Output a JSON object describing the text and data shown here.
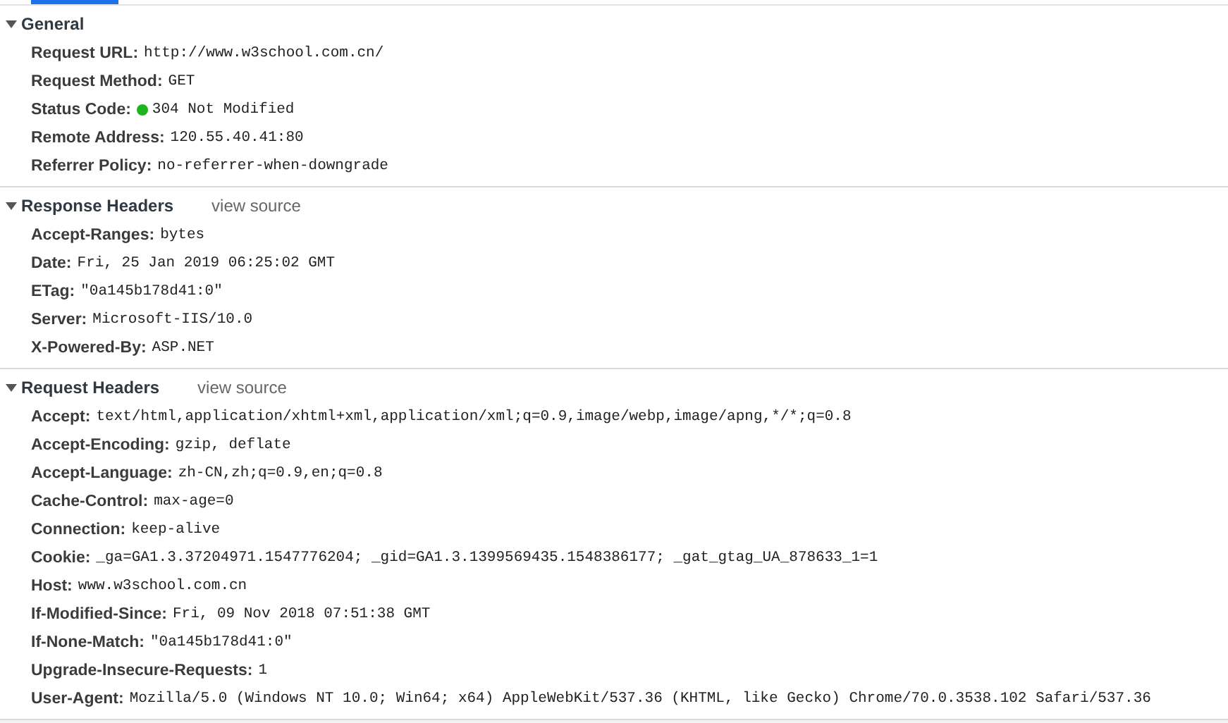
{
  "sections": [
    {
      "title": "General",
      "expanded": true,
      "rows": [
        {
          "kind": "plain",
          "name": "Request URL:",
          "value": "http://www.w3school.com.cn/"
        },
        {
          "kind": "plain",
          "name": "Request Method:",
          "value": "GET"
        },
        {
          "kind": "status",
          "name": "Status Code:",
          "value": "304 Not Modified",
          "color": "#1db51d"
        },
        {
          "kind": "plain",
          "name": "Remote Address:",
          "value": "120.55.40.41:80"
        },
        {
          "kind": "plain",
          "name": "Referrer Policy:",
          "value": "no-referrer-when-downgrade"
        }
      ]
    },
    {
      "title": "Response Headers",
      "link": "view source",
      "expanded": true,
      "rows": [
        {
          "kind": "plain",
          "name": "Accept-Ranges:",
          "value": "bytes"
        },
        {
          "kind": "plain",
          "name": "Date:",
          "value": "Fri, 25 Jan 2019 06:25:02 GMT"
        },
        {
          "kind": "plain",
          "name": "ETag:",
          "value": "\"0a145b178d41:0\""
        },
        {
          "kind": "plain",
          "name": "Server:",
          "value": "Microsoft-IIS/10.0"
        },
        {
          "kind": "plain",
          "name": "X-Powered-By:",
          "value": "ASP.NET"
        }
      ]
    },
    {
      "title": "Request Headers",
      "link": "view source",
      "expanded": true,
      "rows": [
        {
          "kind": "plain",
          "name": "Accept:",
          "value": "text/html,application/xhtml+xml,application/xml;q=0.9,image/webp,image/apng,*/*;q=0.8"
        },
        {
          "kind": "plain",
          "name": "Accept-Encoding:",
          "value": "gzip, deflate"
        },
        {
          "kind": "plain",
          "name": "Accept-Language:",
          "value": "zh-CN,zh;q=0.9,en;q=0.8"
        },
        {
          "kind": "plain",
          "name": "Cache-Control:",
          "value": "max-age=0"
        },
        {
          "kind": "plain",
          "name": "Connection:",
          "value": "keep-alive"
        },
        {
          "kind": "plain",
          "name": "Cookie:",
          "value": "_ga=GA1.3.37204971.1547776204; _gid=GA1.3.1399569435.1548386177; _gat_gtag_UA_878633_1=1"
        },
        {
          "kind": "plain",
          "name": "Host:",
          "value": "www.w3school.com.cn"
        },
        {
          "kind": "plain",
          "name": "If-Modified-Since:",
          "value": "Fri, 09 Nov 2018 07:51:38 GMT"
        },
        {
          "kind": "plain",
          "name": "If-None-Match:",
          "value": "\"0a145b178d41:0\""
        },
        {
          "kind": "plain",
          "name": "Upgrade-Insecure-Requests:",
          "value": "1"
        },
        {
          "kind": "plain",
          "name": "User-Agent:",
          "value": "Mozilla/5.0 (Windows NT 10.0; Win64; x64) AppleWebKit/537.36 (KHTML, like Gecko) Chrome/70.0.3538.102 Safari/537.36"
        }
      ]
    }
  ]
}
